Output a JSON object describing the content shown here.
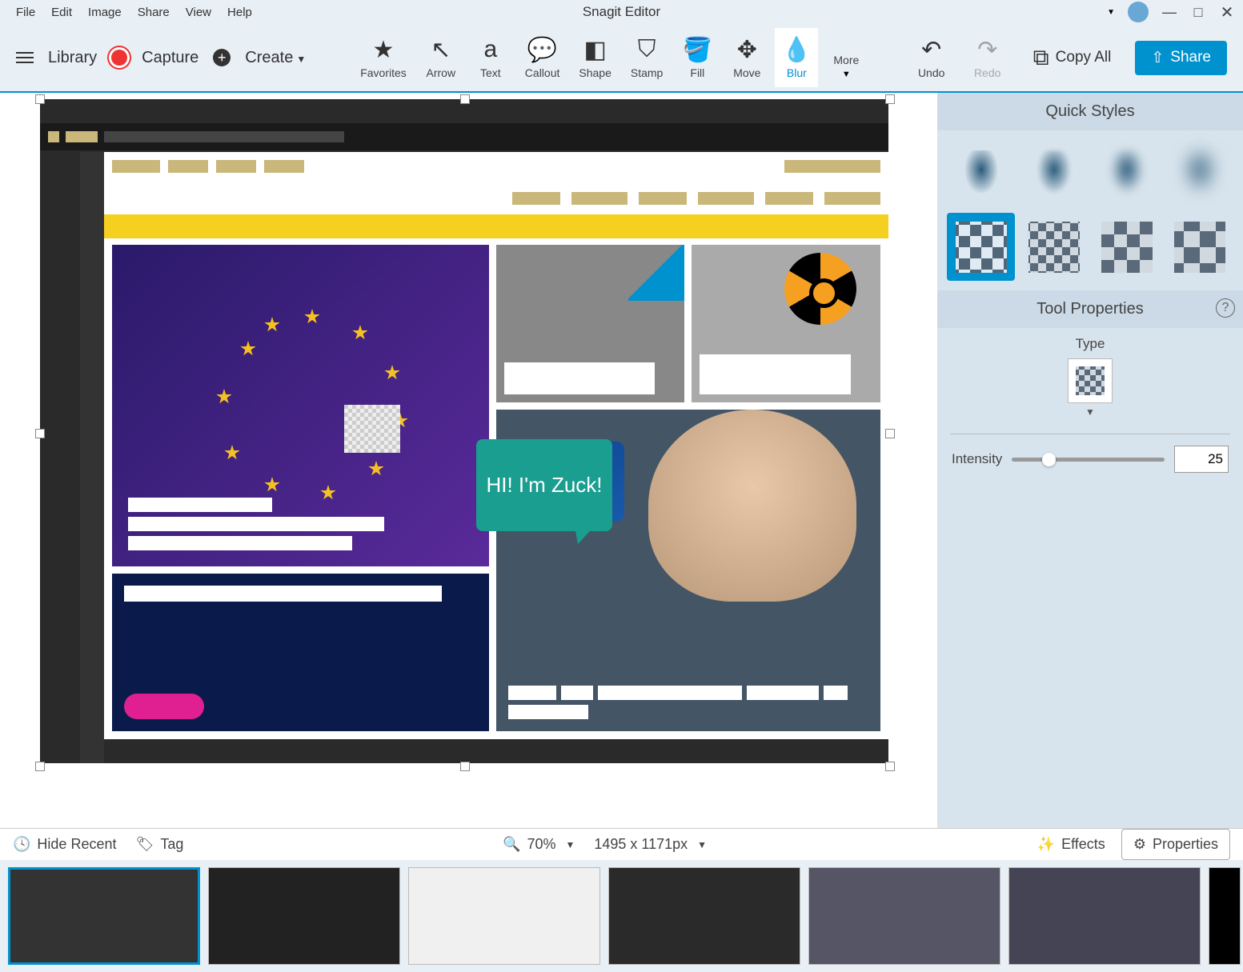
{
  "menubar": {
    "items": [
      "File",
      "Edit",
      "Image",
      "Share",
      "View",
      "Help"
    ],
    "title": "Snagit Editor"
  },
  "toolbar": {
    "library": "Library",
    "capture": "Capture",
    "create": "Create",
    "tools": [
      {
        "name": "favorites",
        "label": "Favorites",
        "icon": "★"
      },
      {
        "name": "arrow",
        "label": "Arrow",
        "icon": "↖"
      },
      {
        "name": "text",
        "label": "Text",
        "icon": "a"
      },
      {
        "name": "callout",
        "label": "Callout",
        "icon": "💬"
      },
      {
        "name": "shape",
        "label": "Shape",
        "icon": "◧"
      },
      {
        "name": "stamp",
        "label": "Stamp",
        "icon": "⛉"
      },
      {
        "name": "fill",
        "label": "Fill",
        "icon": "🪣"
      },
      {
        "name": "move",
        "label": "Move",
        "icon": "✥"
      },
      {
        "name": "blur",
        "label": "Blur",
        "icon": "💧",
        "active": true
      }
    ],
    "more": "More",
    "undo": "Undo",
    "redo": "Redo",
    "copy_all": "Copy All",
    "share": "Share"
  },
  "canvas": {
    "callout": "HI! I'm Zuck!"
  },
  "sidebar": {
    "quick_styles": "Quick Styles",
    "tool_properties": "Tool Properties",
    "type_label": "Type",
    "intensity_label": "Intensity",
    "intensity_value": "25"
  },
  "bottombar": {
    "hide_recent": "Hide Recent",
    "tag": "Tag",
    "zoom": "70%",
    "dimensions": "1495 x 1171px",
    "effects": "Effects",
    "properties": "Properties"
  }
}
